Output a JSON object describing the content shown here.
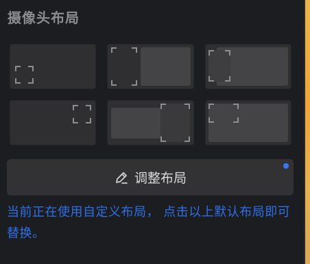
{
  "title": "摄像头布局",
  "layouts": [
    {
      "name": "corner-bottom-left"
    },
    {
      "name": "split-left-small"
    },
    {
      "name": "overlay-left-small"
    },
    {
      "name": "corner-top-right"
    },
    {
      "name": "overlay-right-small"
    },
    {
      "name": "corner-top-left"
    }
  ],
  "adjust_button": {
    "label": "调整布局",
    "icon": "edit-icon",
    "has_notification_dot": true
  },
  "note": "当前正在使用自定义布局， 点击以上默认布局即可替换。",
  "colors": {
    "accent": "#2f6fe6",
    "dot": "#3b76f2",
    "background": "#1c1d21"
  }
}
